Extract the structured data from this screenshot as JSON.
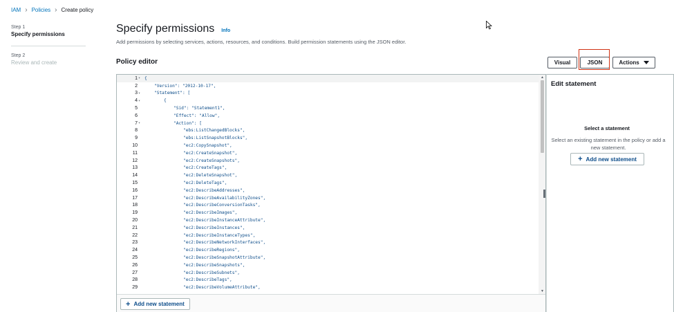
{
  "breadcrumb": {
    "items": [
      "IAM",
      "Policies"
    ],
    "current": "Create policy",
    "separator": "›"
  },
  "steps": [
    {
      "number": "Step 1",
      "title": "Specify permissions",
      "active": true
    },
    {
      "number": "Step 2",
      "title": "Review and create",
      "active": false
    }
  ],
  "header": {
    "title": "Specify permissions",
    "info": "Info",
    "description": "Add permissions by selecting services, actions, resources, and conditions. Build permission statements using the JSON editor."
  },
  "editor": {
    "heading": "Policy editor",
    "add_statement_label": "Add new statement",
    "lines": [
      {
        "n": "1",
        "fold": true,
        "indent": 0,
        "text": "{"
      },
      {
        "n": "2",
        "fold": false,
        "indent": 1,
        "text": "\"Version\": \"2012-10-17\","
      },
      {
        "n": "3",
        "fold": true,
        "indent": 1,
        "text": "\"Statement\": ["
      },
      {
        "n": "4",
        "fold": true,
        "indent": 2,
        "text": "{"
      },
      {
        "n": "5",
        "fold": false,
        "indent": 3,
        "text": "\"Sid\": \"Statement1\","
      },
      {
        "n": "6",
        "fold": false,
        "indent": 3,
        "text": "\"Effect\": \"Allow\","
      },
      {
        "n": "7",
        "fold": true,
        "indent": 3,
        "text": "\"Action\": ["
      },
      {
        "n": "8",
        "fold": false,
        "indent": 4,
        "text": "\"ebs:ListChangedBlocks\","
      },
      {
        "n": "9",
        "fold": false,
        "indent": 4,
        "text": "\"ebs:ListSnapshotBlocks\","
      },
      {
        "n": "10",
        "fold": false,
        "indent": 4,
        "text": "\"ec2:CopySnapshot\","
      },
      {
        "n": "11",
        "fold": false,
        "indent": 4,
        "text": "\"ec2:CreateSnapshot\","
      },
      {
        "n": "12",
        "fold": false,
        "indent": 4,
        "text": "\"ec2:CreateSnapshots\","
      },
      {
        "n": "13",
        "fold": false,
        "indent": 4,
        "text": "\"ec2:CreateTags\","
      },
      {
        "n": "14",
        "fold": false,
        "indent": 4,
        "text": "\"ec2:DeleteSnapshot\","
      },
      {
        "n": "15",
        "fold": false,
        "indent": 4,
        "text": "\"ec2:DeleteTags\","
      },
      {
        "n": "16",
        "fold": false,
        "indent": 4,
        "text": "\"ec2:DescribeAddresses\","
      },
      {
        "n": "17",
        "fold": false,
        "indent": 4,
        "text": "\"ec2:DescribeAvailabilityZones\","
      },
      {
        "n": "18",
        "fold": false,
        "indent": 4,
        "text": "\"ec2:DescribeConversionTasks\","
      },
      {
        "n": "19",
        "fold": false,
        "indent": 4,
        "text": "\"ec2:DescribeImages\","
      },
      {
        "n": "20",
        "fold": false,
        "indent": 4,
        "text": "\"ec2:DescribeInstanceAttribute\","
      },
      {
        "n": "21",
        "fold": false,
        "indent": 4,
        "text": "\"ec2:DescribeInstances\","
      },
      {
        "n": "22",
        "fold": false,
        "indent": 4,
        "text": "\"ec2:DescribeInstanceTypes\","
      },
      {
        "n": "23",
        "fold": false,
        "indent": 4,
        "text": "\"ec2:DescribeNetworkInterfaces\","
      },
      {
        "n": "24",
        "fold": false,
        "indent": 4,
        "text": "\"ec2:DescribeRegions\","
      },
      {
        "n": "25",
        "fold": false,
        "indent": 4,
        "text": "\"ec2:DescribeSnapshotAttribute\","
      },
      {
        "n": "26",
        "fold": false,
        "indent": 4,
        "text": "\"ec2:DescribeSnapshots\","
      },
      {
        "n": "27",
        "fold": false,
        "indent": 4,
        "text": "\"ec2:DescribeSubnets\","
      },
      {
        "n": "28",
        "fold": false,
        "indent": 4,
        "text": "\"ec2:DescribeTags\","
      },
      {
        "n": "29",
        "fold": false,
        "indent": 4,
        "text": "\"ec2:DescribeVolumeAttribute\","
      }
    ]
  },
  "toolbar": {
    "visual_label": "Visual",
    "json_label": "JSON",
    "actions_label": "Actions"
  },
  "side_panel": {
    "title": "Edit statement",
    "subtitle": "Select a statement",
    "text": "Select an existing statement in the policy or add a new statement.",
    "add_label": "Add new statement"
  },
  "colors": {
    "link": "#0073bb",
    "highlight_box": "#d13212",
    "code_string": "#0d4d8a"
  }
}
